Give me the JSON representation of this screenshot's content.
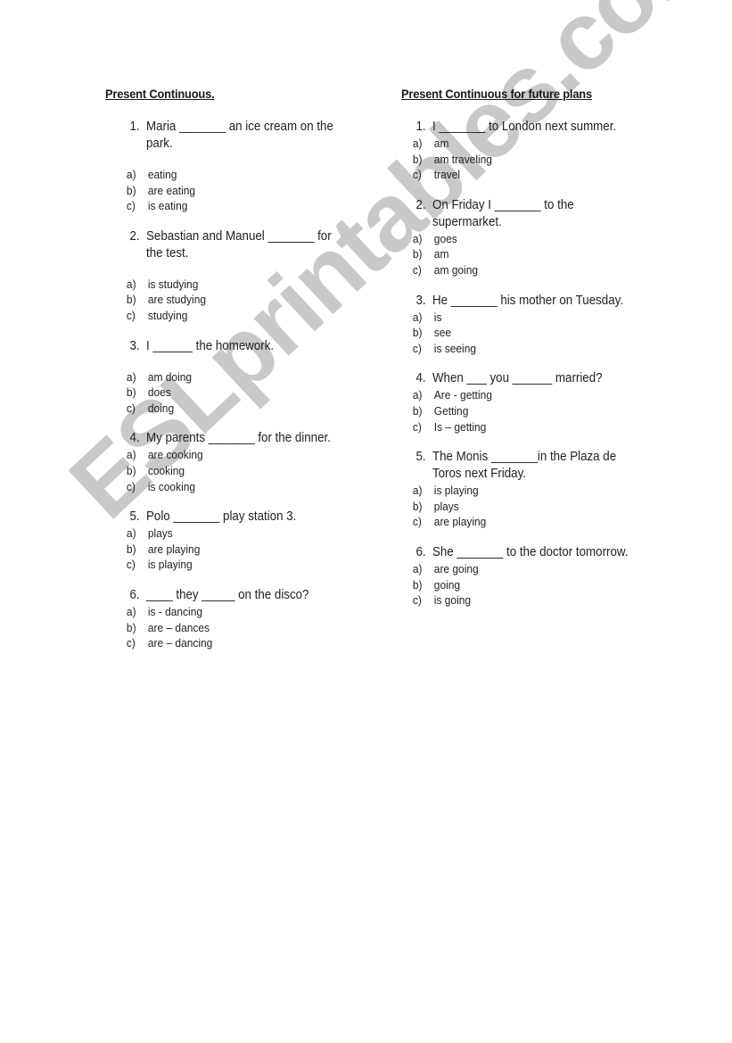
{
  "watermark": "ESLprintables.com",
  "left_section": {
    "title": "Present Continuous.",
    "questions": [
      {
        "num": "1.",
        "text": "Maria _______ an ice cream on the park.",
        "options": [
          {
            "letter": "a)",
            "text": "eating"
          },
          {
            "letter": "b)",
            "text": "are eating"
          },
          {
            "letter": "c)",
            "text": "is eating"
          }
        ]
      },
      {
        "num": "2.",
        "text": "Sebastian and Manuel _______ for the test.",
        "options": [
          {
            "letter": "a)",
            "text": "is studying"
          },
          {
            "letter": "b)",
            "text": "are studying"
          },
          {
            "letter": "c)",
            "text": "studying"
          }
        ]
      },
      {
        "num": "3.",
        "text": "I ______ the homework.",
        "options": [
          {
            "letter": "a)",
            "text": "am doing"
          },
          {
            "letter": "b)",
            "text": "does"
          },
          {
            "letter": "c)",
            "text": "doing"
          }
        ]
      },
      {
        "num": "4.",
        "text": "My parents _______ for the dinner.",
        "options": [
          {
            "letter": "a)",
            "text": "are cooking"
          },
          {
            "letter": "b)",
            "text": "cooking"
          },
          {
            "letter": "c)",
            "text": "is cooking"
          }
        ]
      },
      {
        "num": "5.",
        "text": "Polo _______ play station 3.",
        "options": [
          {
            "letter": "a)",
            "text": "plays"
          },
          {
            "letter": "b)",
            "text": "are playing"
          },
          {
            "letter": "c)",
            "text": "is playing"
          }
        ]
      },
      {
        "num": "6.",
        "text": "____ they _____ on the disco?",
        "options": [
          {
            "letter": "a)",
            "text": "is - dancing"
          },
          {
            "letter": "b)",
            "text": "are – dances"
          },
          {
            "letter": "c)",
            "text": "are – dancing"
          }
        ]
      }
    ]
  },
  "right_section": {
    "title": "Present Continuous for future plans",
    "questions": [
      {
        "num": "1.",
        "text": "I _______ to London next summer.",
        "options": [
          {
            "letter": "a)",
            "text": "am"
          },
          {
            "letter": "b)",
            "text": "am traveling"
          },
          {
            "letter": "c)",
            "text": "travel"
          }
        ]
      },
      {
        "num": "2.",
        "text": "On Friday I _______ to the supermarket.",
        "options": [
          {
            "letter": "a)",
            "text": "goes"
          },
          {
            "letter": "b)",
            "text": "am"
          },
          {
            "letter": "c)",
            "text": "am going"
          }
        ]
      },
      {
        "num": "3.",
        "text": "He _______ his mother on Tuesday.",
        "options": [
          {
            "letter": "a)",
            "text": "is"
          },
          {
            "letter": "b)",
            "text": "see"
          },
          {
            "letter": "c)",
            "text": "is seeing"
          }
        ]
      },
      {
        "num": "4.",
        "text": "When ___ you ______ married?",
        "options": [
          {
            "letter": "a)",
            "text": "Are - getting"
          },
          {
            "letter": "b)",
            "text": "Getting"
          },
          {
            "letter": "c)",
            "text": "Is – getting"
          }
        ]
      },
      {
        "num": "5.",
        "text": "The Monis _______in the Plaza de Toros next Friday.",
        "options": [
          {
            "letter": "a)",
            "text": "is playing"
          },
          {
            "letter": "b)",
            "text": "plays"
          },
          {
            "letter": "c)",
            "text": "are playing"
          }
        ]
      },
      {
        "num": "6.",
        "text": "She _______ to the doctor tomorrow.",
        "options": [
          {
            "letter": "a)",
            "text": "are going"
          },
          {
            "letter": "b)",
            "text": "going"
          },
          {
            "letter": "c)",
            "text": "is going"
          }
        ]
      }
    ]
  }
}
